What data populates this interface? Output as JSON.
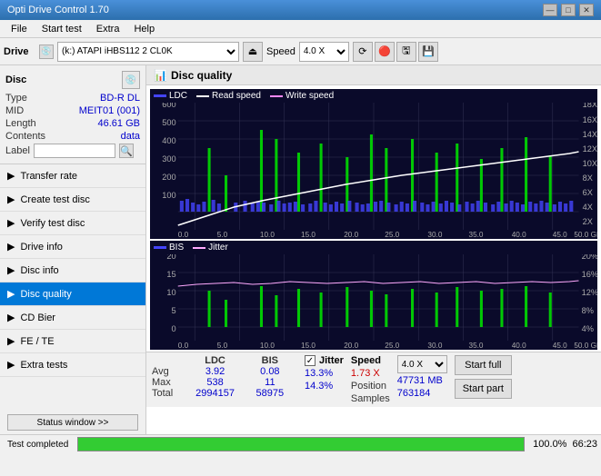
{
  "titleBar": {
    "title": "Opti Drive Control 1.70",
    "minBtn": "—",
    "maxBtn": "□",
    "closeBtn": "✕"
  },
  "menuBar": {
    "items": [
      "File",
      "Start test",
      "Extra",
      "Help"
    ]
  },
  "toolbar": {
    "driveLabel": "Drive",
    "driveValue": "(k:) ATAPI iHBS112  2 CL0K",
    "speedLabel": "Speed",
    "speedValue": "4.0 X",
    "ejectSymbol": "⏏"
  },
  "discPanel": {
    "title": "Disc",
    "typeLabel": "Type",
    "typeValue": "BD-R DL",
    "midLabel": "MID",
    "midValue": "MEIT01 (001)",
    "lengthLabel": "Length",
    "lengthValue": "46.61 GB",
    "contentsLabel": "Contents",
    "contentsValue": "data",
    "labelLabel": "Label",
    "labelValue": ""
  },
  "navItems": [
    {
      "id": "transfer-rate",
      "label": "Transfer rate",
      "active": false
    },
    {
      "id": "create-test-disc",
      "label": "Create test disc",
      "active": false
    },
    {
      "id": "verify-test-disc",
      "label": "Verify test disc",
      "active": false
    },
    {
      "id": "drive-info",
      "label": "Drive info",
      "active": false
    },
    {
      "id": "disc-info",
      "label": "Disc info",
      "active": false
    },
    {
      "id": "disc-quality",
      "label": "Disc quality",
      "active": true
    },
    {
      "id": "cd-bier",
      "label": "CD Bier",
      "active": false
    },
    {
      "id": "fe-te",
      "label": "FE / TE",
      "active": false
    },
    {
      "id": "extra-tests",
      "label": "Extra tests",
      "active": false
    }
  ],
  "statusWindow": {
    "btnLabel": "Status window >>"
  },
  "bottomStatus": {
    "completedText": "Test completed",
    "progressPercent": "100.0%",
    "timeValue": "66:23"
  },
  "chartArea": {
    "title": "Disc quality",
    "topChart": {
      "legendItems": [
        {
          "id": "ldc",
          "label": "LDC",
          "color": "#4444ff"
        },
        {
          "id": "read-speed",
          "label": "Read speed",
          "color": "#ffffff"
        },
        {
          "id": "write-speed",
          "label": "Write speed",
          "color": "#ff88ff"
        }
      ],
      "yAxisLeft": [
        "600",
        "500",
        "400",
        "300",
        "200",
        "100",
        "0"
      ],
      "yAxisRight": [
        "18X",
        "16X",
        "14X",
        "12X",
        "10X",
        "8X",
        "6X",
        "4X",
        "2X"
      ],
      "xAxisLabels": [
        "0.0",
        "5.0",
        "10.0",
        "15.0",
        "20.0",
        "25.0",
        "30.0",
        "35.0",
        "40.0",
        "45.0",
        "50.0 GB"
      ]
    },
    "bottomChart": {
      "legendItems": [
        {
          "id": "bis",
          "label": "BIS",
          "color": "#4444ff"
        },
        {
          "id": "jitter",
          "label": "Jitter",
          "color": "#ffaaff"
        }
      ],
      "yAxisLeft": [
        "20",
        "15",
        "10",
        "5",
        "0"
      ],
      "yAxisRight": [
        "20%",
        "16%",
        "12%",
        "8%",
        "4%"
      ],
      "xAxisLabels": [
        "0.0",
        "5.0",
        "10.0",
        "15.0",
        "20.0",
        "25.0",
        "30.0",
        "35.0",
        "40.0",
        "45.0",
        "50.0 GB"
      ]
    }
  },
  "statsTable": {
    "headers": [
      "",
      "LDC",
      "BIS",
      "",
      "Jitter",
      "Speed",
      "",
      ""
    ],
    "rows": [
      {
        "label": "Avg",
        "ldc": "3.92",
        "bis": "0.08",
        "jitterVal": "13.3%",
        "speed": "1.73 X",
        "speedSelect": "4.0 X"
      },
      {
        "label": "Max",
        "ldc": "538",
        "bis": "11",
        "jitterVal": "14.3%",
        "posLabel": "Position",
        "posVal": "47731 MB"
      },
      {
        "label": "Total",
        "ldc": "2994157",
        "bis": "58975",
        "samplesLabel": "Samples",
        "samplesVal": "763184"
      }
    ],
    "jitterChecked": true,
    "startFullBtn": "Start full",
    "startPartBtn": "Start part"
  }
}
